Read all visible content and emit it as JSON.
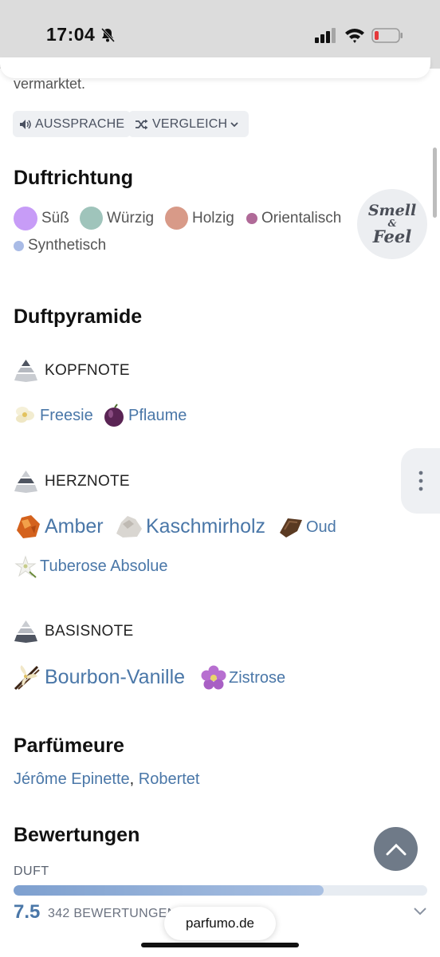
{
  "status_bar": {
    "time": "17:04"
  },
  "intro_tail": "vermarktet.",
  "actions": {
    "pronunciation": "AUSSPRACHE",
    "compare": "VERGLEICH"
  },
  "accords": {
    "title": "Duftrichtung",
    "items": [
      {
        "label": "Süß",
        "color": "#c79cf7"
      },
      {
        "label": "Würzig",
        "color": "#9fc4bb"
      },
      {
        "label": "Holzig",
        "color": "#d89a88"
      },
      {
        "label": "Orientalisch",
        "color": "#b06a98"
      },
      {
        "label": "Synthetisch",
        "color": "#a9bbe6"
      }
    ],
    "badge": {
      "line1": "Smell",
      "amp": "&",
      "line2": "Feel"
    }
  },
  "pyramid": {
    "title": "Duftpyramide",
    "top": {
      "label": "KOPFNOTE",
      "notes": [
        "Freesie",
        "Pflaume"
      ]
    },
    "heart": {
      "label": "HERZNOTE",
      "notes": [
        "Amber",
        "Kaschmirholz",
        "Oud",
        "Tuberose Absolue"
      ]
    },
    "base": {
      "label": "BASISNOTE",
      "notes": [
        "Bourbon-Vanille",
        "Zistrose"
      ]
    }
  },
  "perfumers": {
    "title": "Parfümeure",
    "names": [
      "Jérôme Epinette",
      "Robertet"
    ],
    "separator": ", "
  },
  "ratings": {
    "title": "Bewertungen",
    "scent": {
      "label": "DUFT",
      "score": "7.5",
      "votes": "342 BEWERTUNGEN",
      "fill_fraction": 0.75
    }
  },
  "browser": {
    "url": "parfumo.de"
  }
}
